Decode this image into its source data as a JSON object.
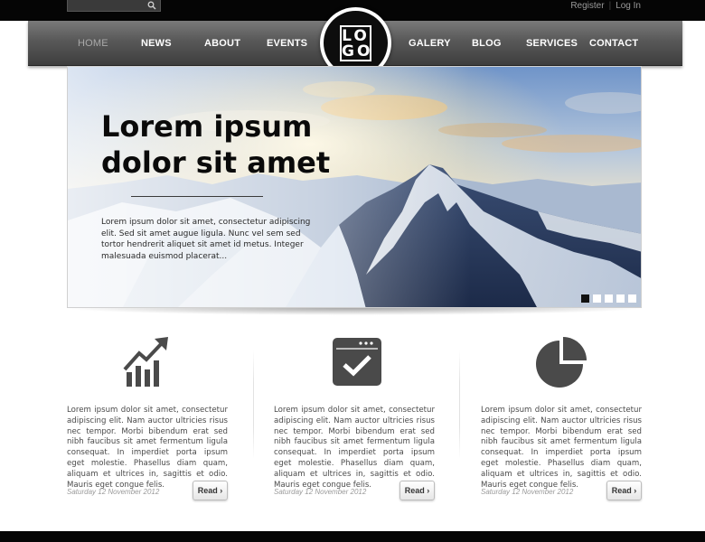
{
  "search": {
    "placeholder": "",
    "icon": "search-icon"
  },
  "toplinks": {
    "register": "Register",
    "separator": "|",
    "login": "Log In"
  },
  "nav": {
    "items": [
      {
        "label": "HOME",
        "active": true
      },
      {
        "label": "NEWS"
      },
      {
        "label": "ABOUT"
      },
      {
        "label": "EVENTS"
      },
      {
        "label": "GALERY"
      },
      {
        "label": "BLOG"
      },
      {
        "label": "SERVICES"
      },
      {
        "label": "CONTACT"
      }
    ]
  },
  "logo": {
    "line1": "LO",
    "line2": "GO"
  },
  "hero": {
    "title_line1": "Lorem ipsum",
    "title_line2": "dolor sit amet",
    "text": "Lorem ipsum dolor sit amet, consectetur adipiscing elit. Sed sit amet augue ligula. Nunc vel sem sed tortor hendrerit aliquet sit amet id metus. Integer malesuada euismod placerat...",
    "slides": 5,
    "active_slide": 1
  },
  "columns": [
    {
      "icon": "chart-growth-icon",
      "text": "Lorem ipsum dolor sit amet, consectetur adipiscing elit. Nam auctor ultricies risus nec tempor. Morbi bibendum erat sed nibh faucibus sit amet fermentum ligula consequat. In imperdiet porta ipsum eget molestie. Phasellus diam quam, aliquam et ultrices in, sagittis et odio. Mauris eget congue felis.",
      "date": "Saturday 12 November 2012",
      "button": "Read"
    },
    {
      "icon": "browser-check-icon",
      "text": "Lorem ipsum dolor sit amet, consectetur adipiscing elit. Nam auctor ultricies risus nec tempor. Morbi bibendum erat sed nibh faucibus sit amet fermentum ligula consequat. In imperdiet porta ipsum eget molestie. Phasellus diam quam, aliquam et ultrices in, sagittis et odio. Mauris eget congue felis.",
      "date": "Saturday 12 November 2012",
      "button": "Read"
    },
    {
      "icon": "pie-chart-icon",
      "text": "Lorem ipsum dolor sit amet, consectetur adipiscing elit. Nam auctor ultricies risus nec tempor. Morbi bibendum erat sed nibh faucibus sit amet fermentum ligula consequat. In imperdiet porta ipsum eget molestie. Phasellus diam quam, aliquam et ultrices in, sagittis et odio. Mauris eget congue felis.",
      "date": "Saturday 12 November 2012",
      "button": "Read"
    }
  ],
  "colors": {
    "nav_bg": "#585858",
    "icon": "#4a4a4a",
    "active_dot": "#111111",
    "topbar": "#050505"
  }
}
